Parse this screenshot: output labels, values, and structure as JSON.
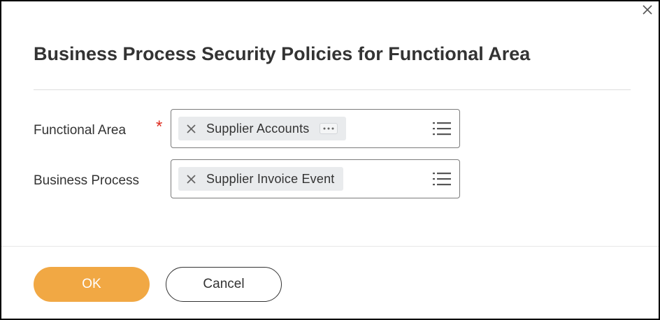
{
  "dialog": {
    "title": "Business Process Security Policies for Functional Area",
    "close_icon": "close-icon"
  },
  "fields": {
    "functional_area": {
      "label": "Functional Area",
      "required_marker": "*",
      "value": "Supplier Accounts",
      "remove_icon": "x-icon",
      "more_icon": "ellipsis-icon",
      "list_icon": "list-icon"
    },
    "business_process": {
      "label": "Business Process",
      "value": "Supplier Invoice Event",
      "remove_icon": "x-icon",
      "list_icon": "list-icon"
    }
  },
  "footer": {
    "ok_label": "OK",
    "cancel_label": "Cancel"
  },
  "colors": {
    "ok_button": "#f1a844",
    "required": "#de2e21",
    "pill_background": "#e9ebed",
    "text": "#333333"
  }
}
